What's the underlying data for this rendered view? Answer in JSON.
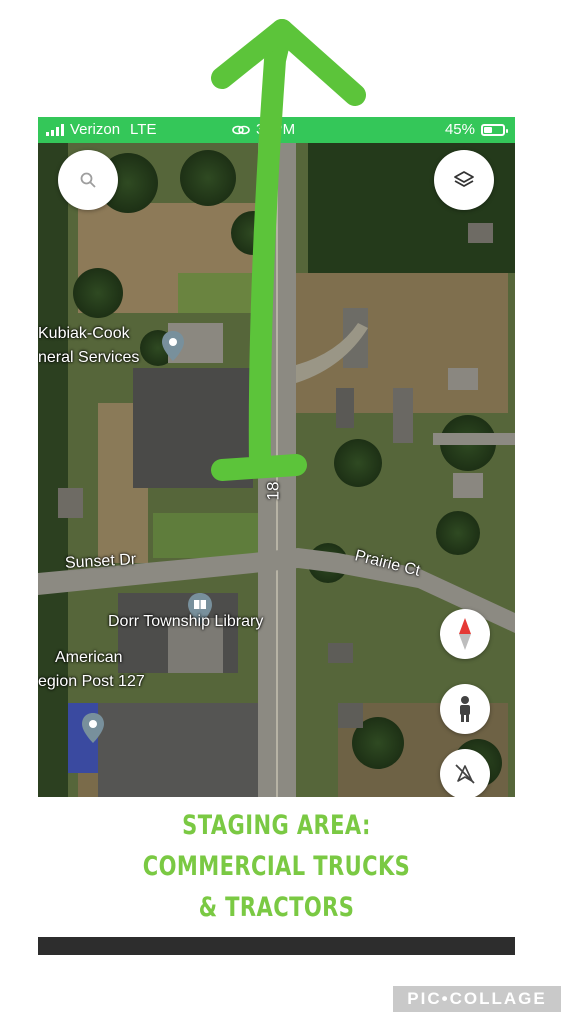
{
  "status_bar": {
    "carrier": "Verizon",
    "network": "LTE",
    "time": "3:  PM",
    "battery_percent": "45%",
    "battery_level": 0.45,
    "bar_color": "#34c759"
  },
  "map": {
    "search_button_icon": "search-icon",
    "layers_button_icon": "layers-icon",
    "compass_icon": "compass-icon",
    "street_view_icon": "pegman-icon",
    "navigation_icon": "navigation-off-icon",
    "labels": {
      "kubiak_line1": "Kubiak-Cook",
      "kubiak_line2": "neral Services",
      "sunset_dr": "Sunset Dr",
      "prairie_ct": "Prairie Ct",
      "library": "Dorr Township Library",
      "american_line1": "American",
      "american_line2": "egion Post 127",
      "road_number": "18"
    }
  },
  "caption": {
    "line1": "STAGING AREA:",
    "line2": "COMMERCIAL TRUCKS",
    "line3": "& TRACTORS",
    "color": "#7ac943"
  },
  "annotation": {
    "arrow_color": "#5cc43a"
  },
  "watermark": "PIC•COLLAGE"
}
